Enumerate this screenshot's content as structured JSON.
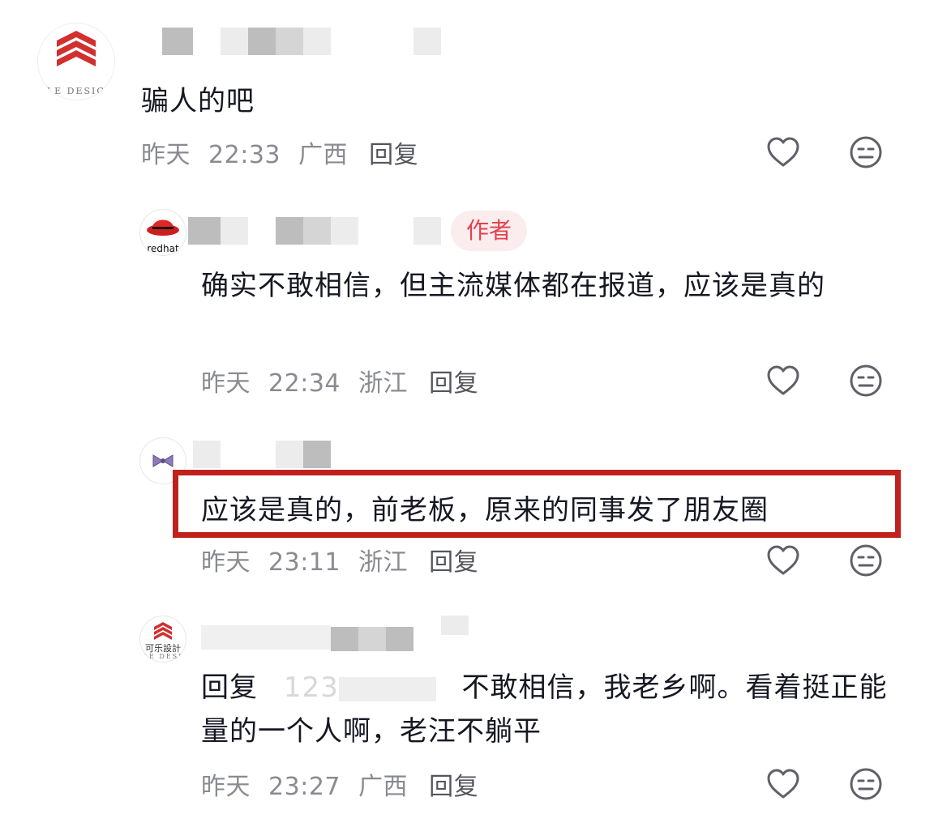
{
  "comments": [
    {
      "text": "骗人的吧",
      "date": "昨天",
      "time": "22:33",
      "location": "广西",
      "reply_label": "回复",
      "avatar_text": "LE DESIG"
    },
    {
      "text": "确实不敢相信，但主流媒体都在报道，应该是真的",
      "date": "昨天",
      "time": "22:34",
      "location": "浙江",
      "reply_label": "回复",
      "author_tag": "作者",
      "avatar_text": "redhat"
    },
    {
      "text": "应该是真的，前老板，原来的同事发了朋友圈",
      "date": "昨天",
      "time": "23:11",
      "location": "浙江",
      "reply_label": "回复"
    },
    {
      "reply_prefix": "回复",
      "reply_to": "123",
      "text": "不敢相信，我老乡啊。看着挺正能量的一个人啊，老汪不躺平",
      "date": "昨天",
      "time": "23:27",
      "location": "广西",
      "reply_label": "回复",
      "avatar_text_top": "可乐設計",
      "avatar_text_bottom": "LE DESI"
    }
  ],
  "icons": {
    "like": "heart-outline-icon",
    "dislike": "neutral-face-icon"
  },
  "colors": {
    "highlight_border": "#c1211b",
    "author_tag_text": "#e4404b",
    "author_tag_bg": "#fbecee",
    "meta_text": "#8a8b91"
  }
}
